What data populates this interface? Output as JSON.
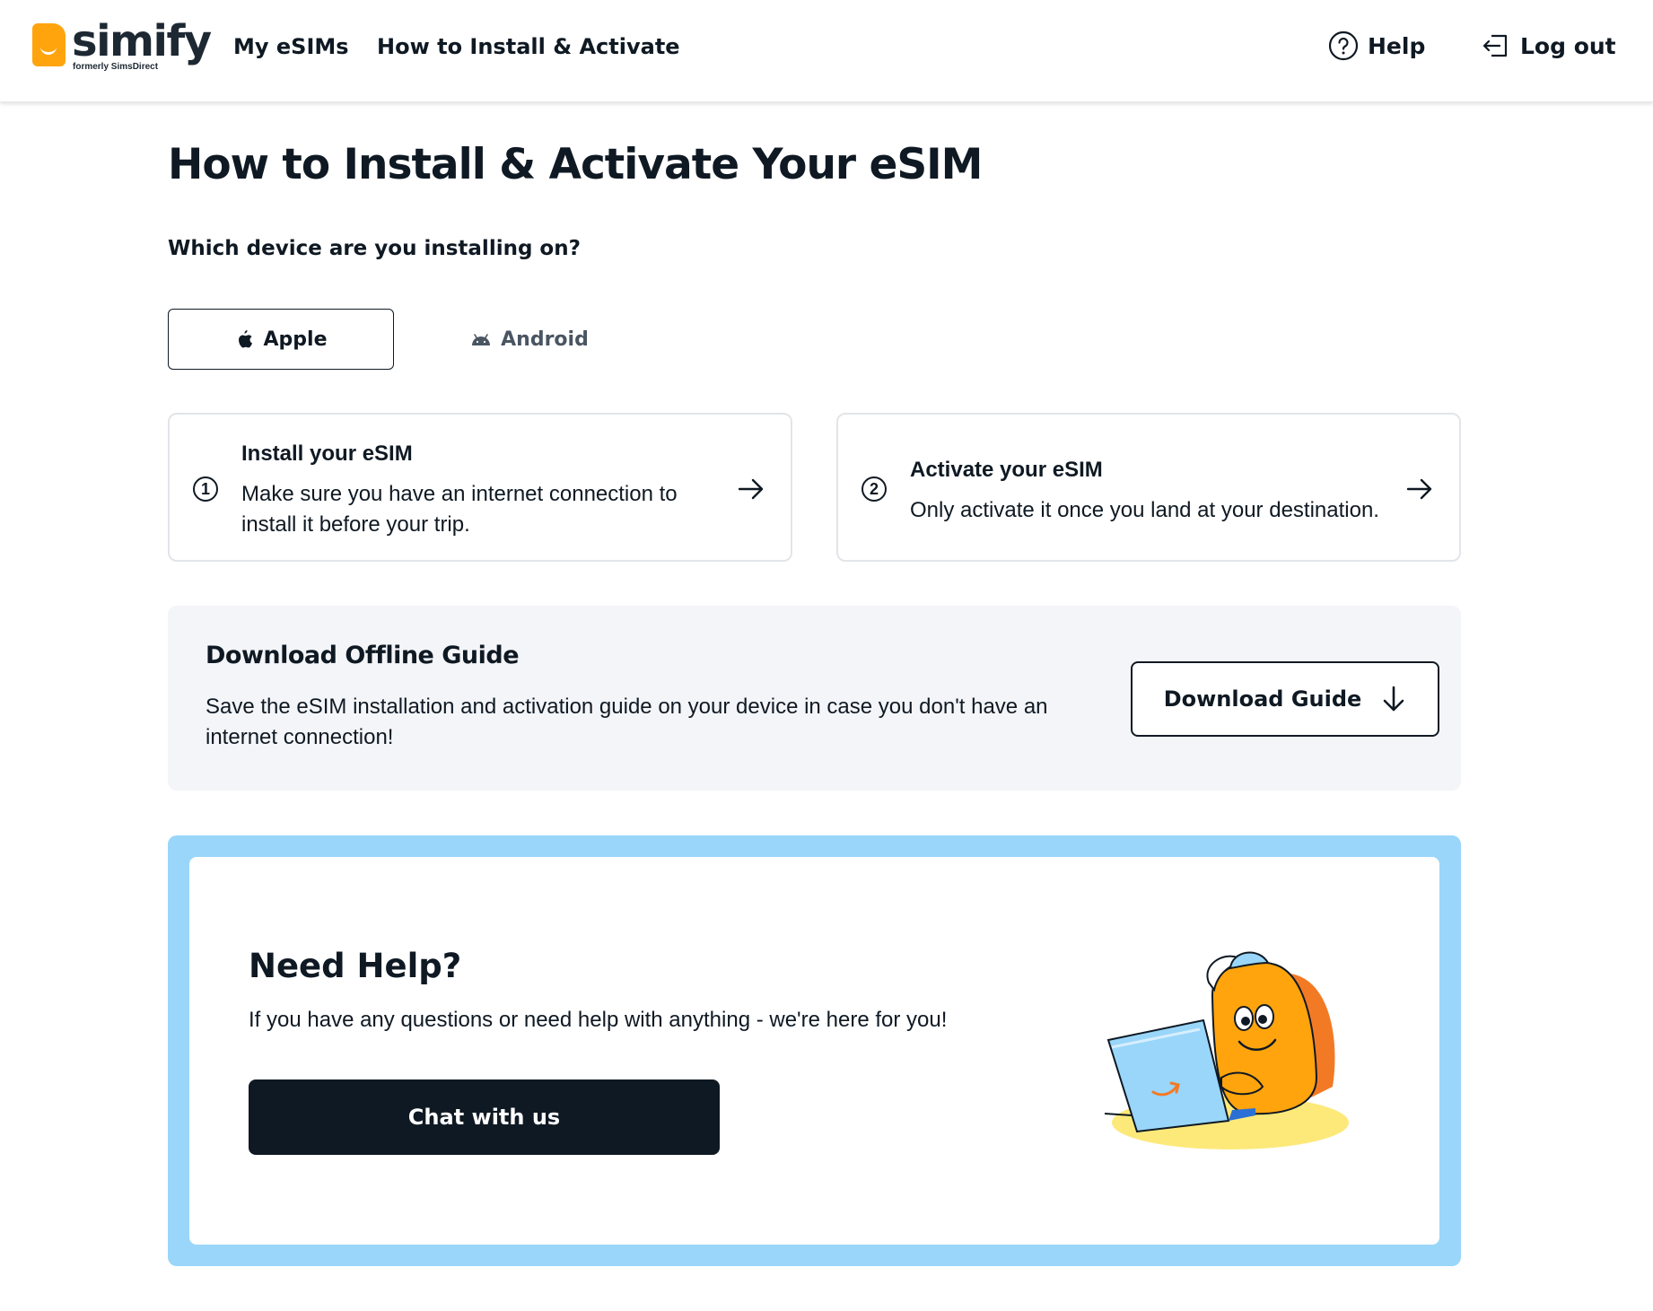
{
  "header": {
    "logo": {
      "name": "simify",
      "tagline": "formerly SimsDirect"
    },
    "nav": [
      {
        "label": "My eSIMs"
      },
      {
        "label": "How to Install & Activate"
      }
    ],
    "help_label": "Help",
    "logout_label": "Log out"
  },
  "main": {
    "title": "How to Install & Activate Your eSIM",
    "device_question": "Which device are you installing on?",
    "tabs": [
      {
        "label": "Apple",
        "icon": "apple-icon",
        "selected": true
      },
      {
        "label": "Android",
        "icon": "android-icon",
        "selected": false
      }
    ],
    "steps": [
      {
        "number": "1",
        "title": "Install your eSIM",
        "description": "Make sure you have an internet connection to install it before your trip."
      },
      {
        "number": "2",
        "title": "Activate your eSIM",
        "description": "Only activate it once you land at your destination."
      }
    ],
    "offline_guide": {
      "title": "Download Offline Guide",
      "description": "Save the eSIM installation and activation guide on your device in case you don't have an internet connection!",
      "button_label": "Download Guide"
    },
    "help_box": {
      "title": "Need Help?",
      "description": "If you have any questions or need help with anything - we're here for you!",
      "button_label": "Chat with us"
    }
  },
  "colors": {
    "brand_orange": "#ffa40d",
    "dark": "#0f1923",
    "help_border": "#99d6fa",
    "panel_gray": "#f4f5f8"
  }
}
